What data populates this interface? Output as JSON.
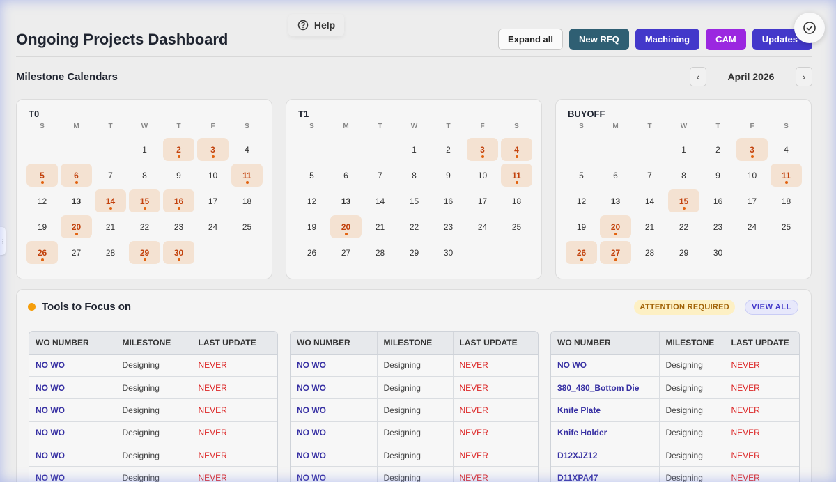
{
  "help": {
    "label": "Help",
    "icon": "help-circle-icon"
  },
  "header": {
    "title": "Ongoing Projects Dashboard",
    "buttons": {
      "expand_all": "Expand all",
      "new_rfq": "New RFQ",
      "machining": "Machining",
      "cam": "CAM",
      "updates": "Updates"
    },
    "status_icon": "check-circle-icon"
  },
  "milestones": {
    "title": "Milestone Calendars",
    "month": "April 2026",
    "prev": "‹",
    "next": "›",
    "days_of_week": [
      "S",
      "M",
      "T",
      "W",
      "T",
      "F",
      "S"
    ],
    "first_weekday": 3,
    "days_in_month": 30,
    "today": 13,
    "calendars": [
      {
        "title": "T0",
        "highlighted": [
          2,
          3,
          5,
          6,
          11,
          14,
          15,
          16,
          20,
          26,
          29,
          30
        ]
      },
      {
        "title": "T1",
        "highlighted": [
          3,
          4,
          11,
          20
        ]
      },
      {
        "title": "BUYOFF",
        "highlighted": [
          3,
          11,
          15,
          20,
          26,
          27
        ]
      }
    ]
  },
  "focus": {
    "title": "Tools to Focus on",
    "attention_badge": "ATTENTION REQUIRED",
    "view_all": "VIEW ALL",
    "columns": [
      "WO NUMBER",
      "MILESTONE",
      "LAST UPDATE"
    ],
    "tables": [
      {
        "rows": [
          [
            "NO WO",
            "Designing",
            "NEVER"
          ],
          [
            "NO WO",
            "Designing",
            "NEVER"
          ],
          [
            "NO WO",
            "Designing",
            "NEVER"
          ],
          [
            "NO WO",
            "Designing",
            "NEVER"
          ],
          [
            "NO WO",
            "Designing",
            "NEVER"
          ],
          [
            "NO WO",
            "Designing",
            "NEVER"
          ]
        ]
      },
      {
        "rows": [
          [
            "NO WO",
            "Designing",
            "NEVER"
          ],
          [
            "NO WO",
            "Designing",
            "NEVER"
          ],
          [
            "NO WO",
            "Designing",
            "NEVER"
          ],
          [
            "NO WO",
            "Designing",
            "NEVER"
          ],
          [
            "NO WO",
            "Designing",
            "NEVER"
          ],
          [
            "NO WO",
            "Designing",
            "NEVER"
          ]
        ]
      },
      {
        "rows": [
          [
            "NO WO",
            "Designing",
            "NEVER"
          ],
          [
            "380_480_Bottom Die",
            "Designing",
            "NEVER"
          ],
          [
            "Knife Plate",
            "Designing",
            "NEVER"
          ],
          [
            "Knife Holder",
            "Designing",
            "NEVER"
          ],
          [
            "D12XJZ12",
            "Designing",
            "NEVER"
          ],
          [
            "D11XPA47",
            "Designing",
            "NEVER"
          ]
        ]
      }
    ]
  }
}
